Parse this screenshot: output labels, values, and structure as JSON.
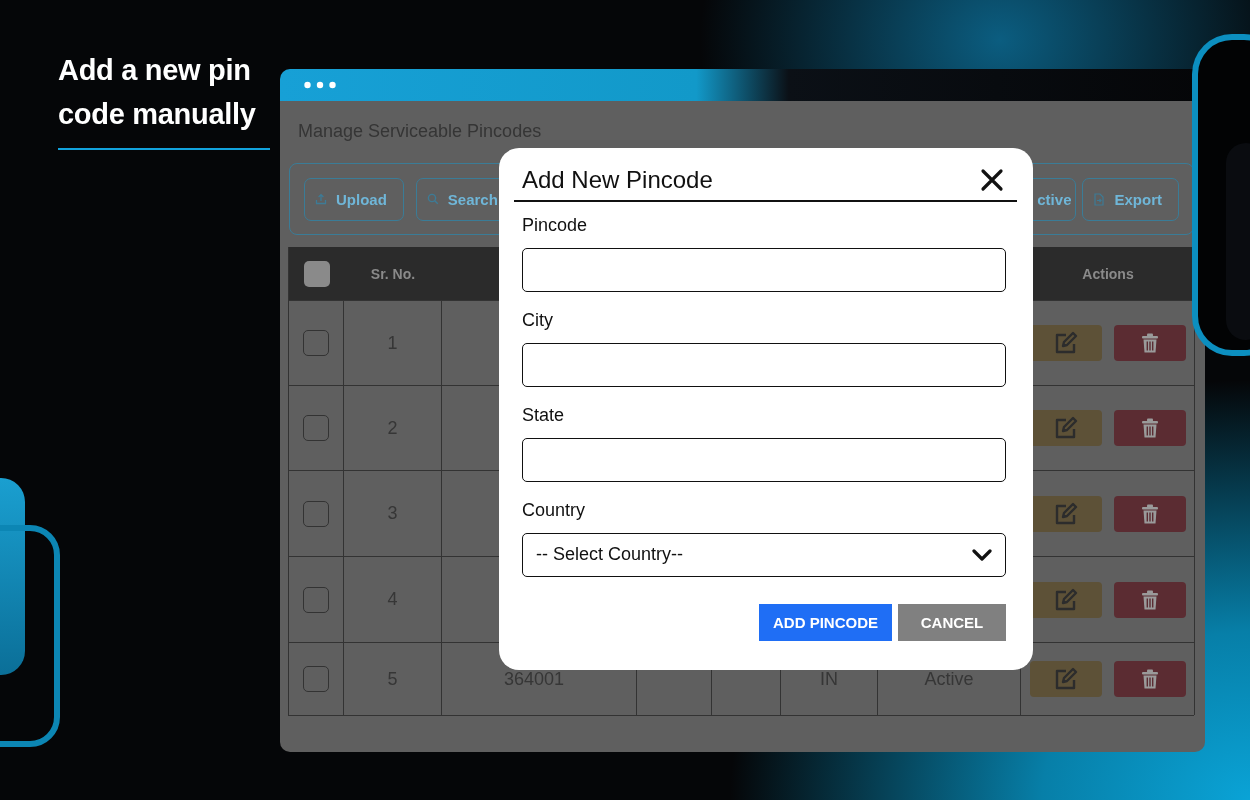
{
  "promo": {
    "heading": "Add a new pin code manually"
  },
  "page": {
    "title": "Manage Serviceable Pincodes"
  },
  "toolbar": [
    {
      "label": "Upload",
      "kind": "upload"
    },
    {
      "label": "Search",
      "kind": "search"
    },
    {
      "label": "ctive",
      "kind": "plain"
    },
    {
      "label": "Export",
      "kind": "export"
    }
  ],
  "table": {
    "header": {
      "checked": false,
      "sr_no": "Sr. No.",
      "actions": "Actions"
    },
    "rows": [
      {
        "checked": false,
        "sr_no": "1"
      },
      {
        "checked": false,
        "sr_no": "2"
      },
      {
        "checked": false,
        "sr_no": "3"
      },
      {
        "checked": false,
        "sr_no": "4"
      },
      {
        "checked": false,
        "sr_no": "5",
        "pincode": "364001",
        "country": "IN",
        "status": "Active"
      }
    ]
  },
  "dialog": {
    "title": "Add New Pincode",
    "fields": [
      {
        "label": "Pincode",
        "kind": "text"
      },
      {
        "label": "City",
        "kind": "text"
      },
      {
        "label": "State",
        "kind": "text"
      },
      {
        "label": "Country",
        "kind": "select",
        "value": "-- Select Country--"
      }
    ],
    "buttons": [
      {
        "label": "ADD PINCODE",
        "kind": "primary"
      },
      {
        "label": "CANCEL",
        "kind": "secondary"
      }
    ]
  }
}
